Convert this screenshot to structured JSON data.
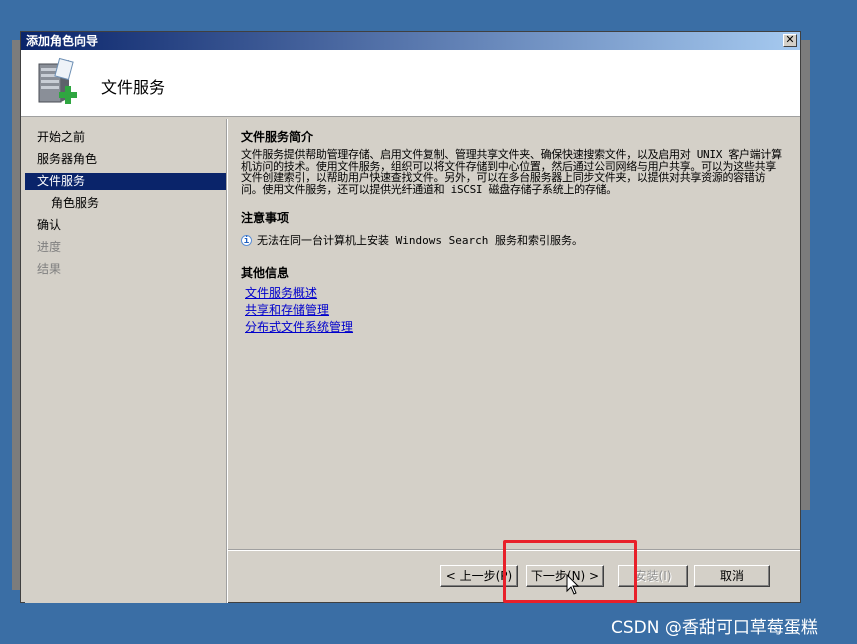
{
  "window": {
    "title": "添加角色向导",
    "close_label": "✕"
  },
  "header": {
    "title": "文件服务"
  },
  "nav": {
    "items": [
      {
        "label": "开始之前",
        "state": "normal"
      },
      {
        "label": "服务器角色",
        "state": "normal"
      },
      {
        "label": "文件服务",
        "state": "active"
      },
      {
        "label": "角色服务",
        "state": "sub"
      },
      {
        "label": "确认",
        "state": "normal"
      },
      {
        "label": "进度",
        "state": "disabled"
      },
      {
        "label": "结果",
        "state": "disabled"
      }
    ]
  },
  "content": {
    "intro_heading": "文件服务简介",
    "intro_text": "文件服务提供帮助管理存储、启用文件复制、管理共享文件夹、确保快速搜索文件，以及启用对 UNIX 客户端计算机访问的技术。使用文件服务，组织可以将文件存储到中心位置，然后通过公司网络与用户共享。可以为这些共享文件创建索引，以帮助用户快速查找文件。另外，可以在多台服务器上同步文件夹，以提供对共享资源的容错访问。使用文件服务，还可以提供光纤通道和 iSCSI 磁盘存储子系统上的存储。",
    "notes_heading": "注意事项",
    "note_text": "无法在同一台计算机上安装 Windows Search 服务和索引服务。",
    "more_heading": "其他信息",
    "links": [
      "文件服务概述",
      "共享和存储管理",
      "分布式文件系统管理"
    ]
  },
  "buttons": {
    "back": "< 上一步(P)",
    "next": "下一步(N) >",
    "install": "安装(I)",
    "cancel": "取消"
  },
  "watermark": "CSDN @香甜可口草莓蛋糕"
}
